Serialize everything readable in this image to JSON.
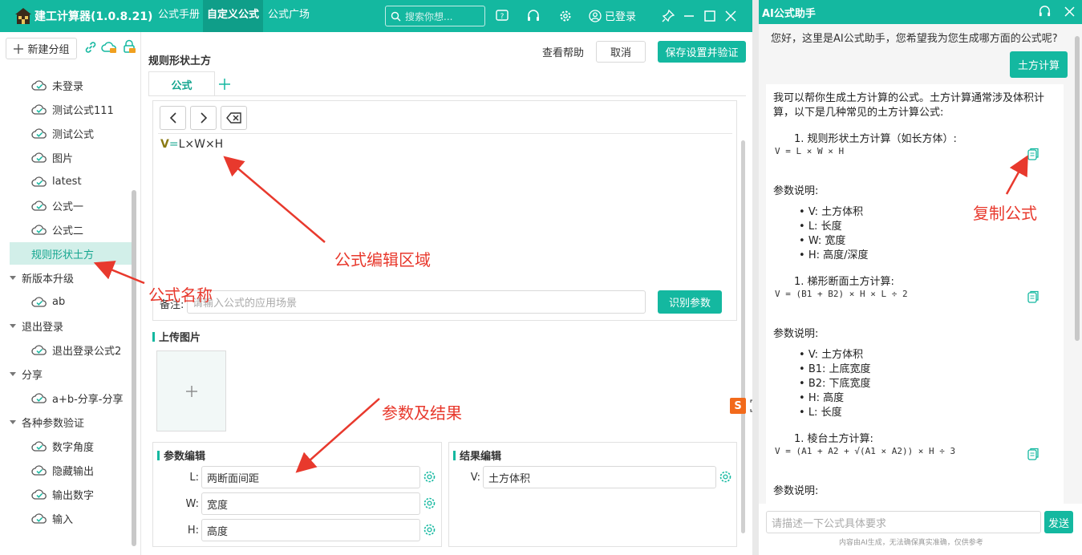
{
  "app": {
    "title": "建工计算器(1.0.8.21)"
  },
  "top_tabs": [
    "公式手册",
    "自定义公式",
    "公式广场"
  ],
  "search": {
    "placeholder": "搜索你想..."
  },
  "login_status": "已登录",
  "sidebar": {
    "new_group": "新建分组",
    "items": [
      {
        "label": "未登录",
        "kind": "formula"
      },
      {
        "label": "测试公式111",
        "kind": "formula"
      },
      {
        "label": "测试公式",
        "kind": "formula"
      },
      {
        "label": "图片",
        "kind": "formula"
      },
      {
        "label": "latest",
        "kind": "formula"
      },
      {
        "label": "公式一",
        "kind": "formula"
      },
      {
        "label": "公式二",
        "kind": "formula"
      },
      {
        "label": "规则形状土方",
        "kind": "formula",
        "active": true
      },
      {
        "label": "新版本升级",
        "kind": "group"
      },
      {
        "label": "ab",
        "kind": "formula"
      },
      {
        "label": "退出登录",
        "kind": "group"
      },
      {
        "label": "退出登录公式2",
        "kind": "formula"
      },
      {
        "label": "分享",
        "kind": "group"
      },
      {
        "label": "a+b-分享-分享",
        "kind": "formula"
      },
      {
        "label": "各种参数验证",
        "kind": "group"
      },
      {
        "label": "数字角度",
        "kind": "formula"
      },
      {
        "label": "隐藏输出",
        "kind": "formula"
      },
      {
        "label": "输出数字",
        "kind": "formula"
      },
      {
        "label": "输入",
        "kind": "formula"
      }
    ]
  },
  "main": {
    "formula_name": "规则形状土方",
    "help": "查看帮助",
    "cancel": "取消",
    "save": "保存设置并验证",
    "tab": "公式",
    "formula_var": "V",
    "formula_eq": "=",
    "formula_rhs": "L×W×H",
    "remark_label": "备注:",
    "remark_placeholder": "请输入公式的应用场景",
    "identify": "识别参数",
    "upload_title": "上传图片",
    "params_title": "参数编辑",
    "results_title": "结果编辑",
    "params": [
      {
        "name": "L:",
        "value": "两断面间距"
      },
      {
        "name": "W:",
        "value": "宽度"
      },
      {
        "name": "H:",
        "value": "高度"
      }
    ],
    "results": [
      {
        "name": "V:",
        "value": "土方体积"
      }
    ]
  },
  "annotations": {
    "editor": "公式编辑区域",
    "name": "公式名称",
    "params": "参数及结果",
    "copy": "复制公式"
  },
  "ai": {
    "title": "AI公式助手",
    "greeting": "您好，这里是AI公式助手，您希望我为您生成哪方面的公式呢?",
    "user_msg": "土方计算",
    "intro": "我可以帮你生成土方计算的公式。土方计算通常涉及体积计算，以下是几种常见的土方计算公式:",
    "param_title": "参数说明:",
    "sections": [
      {
        "title": "1. 规则形状土方计算（如长方体）:",
        "formula": "V = L × W × H",
        "params": [
          "V: 土方体积",
          "L: 长度",
          "W: 宽度",
          "H: 高度/深度"
        ]
      },
      {
        "title": "1. 梯形断面土方计算:",
        "formula": "V = (B1 + B2) × H × L ÷ 2",
        "params": [
          "V: 土方体积",
          "B1: 上底宽度",
          "B2: 下底宽度",
          "H: 高度",
          "L: 长度"
        ]
      },
      {
        "title": "1. 棱台土方计算:",
        "formula": "V = (A1 + A2 + √(A1 × A2)) × H ÷ 3",
        "params": []
      }
    ],
    "input_placeholder": "请描述一下公式具体要求",
    "send": "发送",
    "footer": "内容由AI生成，无法确保真实准确，仅供参考",
    "sogou_badge": "S"
  }
}
